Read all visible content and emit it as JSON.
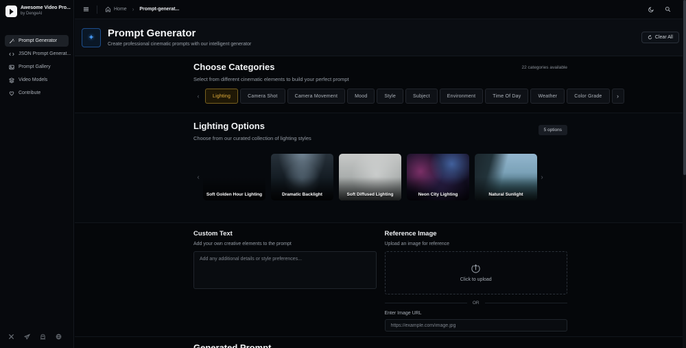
{
  "app": {
    "name": "Awesome Video Pro...",
    "byline": "by DengeAI"
  },
  "sidebar": {
    "items": [
      {
        "label": "Prompt Generator",
        "icon": "wand-icon",
        "active": true
      },
      {
        "label": "JSON Prompt Generat...",
        "icon": "code-icon",
        "active": false
      },
      {
        "label": "Prompt Gallery",
        "icon": "gallery-icon",
        "active": false
      },
      {
        "label": "Video Models",
        "icon": "layers-icon",
        "active": false
      },
      {
        "label": "Contribute",
        "icon": "heart-icon",
        "active": false
      }
    ],
    "social_icons": [
      "x-icon",
      "telegram-icon",
      "ghost-icon",
      "globe-icon"
    ]
  },
  "topbar": {
    "breadcrumb": {
      "home": "Home",
      "separator": "›",
      "current": "Prompt-generat..."
    },
    "icons": [
      "menu-icon",
      "home-icon",
      "moon-icon",
      "search-icon"
    ]
  },
  "page_header": {
    "title": "Prompt Generator",
    "subtitle": "Create professional cinematic prompts with our intelligent generator",
    "clear_all_label": "Clear All",
    "icon": "sparkles-icon"
  },
  "categories": {
    "title": "Choose Categories",
    "subtitle": "Select from different cinematic elements to build your perfect prompt",
    "available_text": "22 categories available",
    "active_chip": "Lighting",
    "chips": [
      "Lighting",
      "Camera Shot",
      "Camera Movement",
      "Mood",
      "Style",
      "Subject",
      "Environment",
      "Time Of Day",
      "Weather",
      "Color Grade"
    ]
  },
  "options": {
    "title": "Lighting Options",
    "subtitle": "Choose from our curated collection of lighting styles",
    "count_badge": "5 options",
    "cards": [
      {
        "label": "Soft Golden Hour Lighting"
      },
      {
        "label": "Dramatic Backlight"
      },
      {
        "label": "Soft Diffused Lighting"
      },
      {
        "label": "Neon City Lighting"
      },
      {
        "label": "Natural Sunlight"
      }
    ]
  },
  "custom_text": {
    "title": "Custom Text",
    "subtitle": "Add your own creative elements to the prompt",
    "placeholder": "Add any additional details or style preferences...",
    "value": ""
  },
  "reference_image": {
    "title": "Reference Image",
    "subtitle": "Upload an image for reference",
    "upload_text": "Click to upload",
    "or_text": "OR",
    "url_label": "Enter Image URL",
    "url_placeholder": "https://example.com/image.jpg",
    "url_value": ""
  },
  "generated": {
    "title": "Generated Prompt"
  },
  "colors": {
    "accent_amber": "#e9b33c",
    "accent_blue": "#4596f0",
    "background": "#04060a",
    "panel": "#0a0d12"
  }
}
